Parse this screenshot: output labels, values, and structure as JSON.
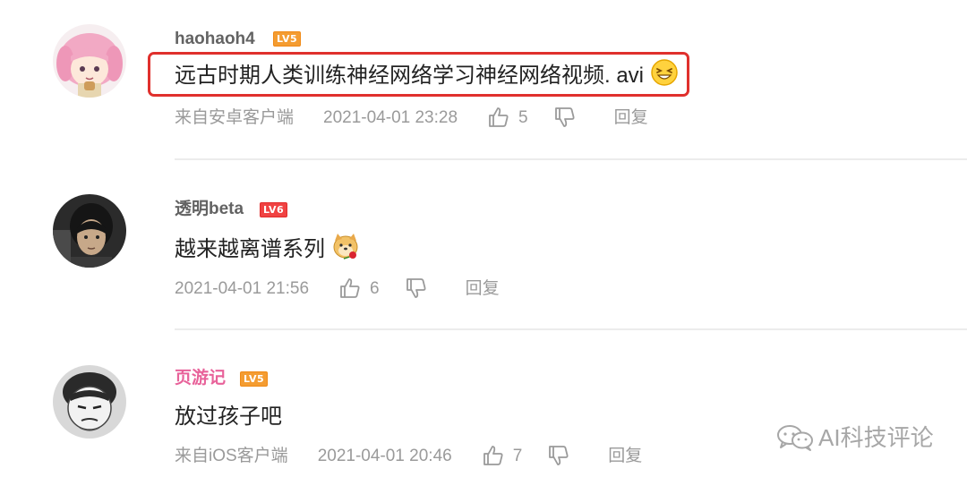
{
  "comments": [
    {
      "username": "haohaoh4",
      "level": "LV5",
      "text": "远古时期人类训练神经网络学习神经网络视频. avi",
      "emoji": "grinning-squint-emoji",
      "source": "来自安卓客户端",
      "time": "2021-04-01 23:28",
      "likes": "5",
      "reply": "回复"
    },
    {
      "username": "透明beta",
      "level": "LV6",
      "text": "越来越离谱系列",
      "emoji": "doge-rose-emoji",
      "source": "",
      "time": "2021-04-01 21:56",
      "likes": "6",
      "reply": "回复"
    },
    {
      "username": "页游记",
      "level": "LV5",
      "text": "放过孩子吧",
      "emoji": "",
      "source": "来自iOS客户端",
      "time": "2021-04-01 20:46",
      "likes": "7",
      "reply": "回复"
    }
  ],
  "watermark": "AI科技评论",
  "colors": {
    "highlight": "#e0302d",
    "level_orange": "#f49c31",
    "level_red": "#f04242",
    "pink_username": "#e8629a"
  }
}
